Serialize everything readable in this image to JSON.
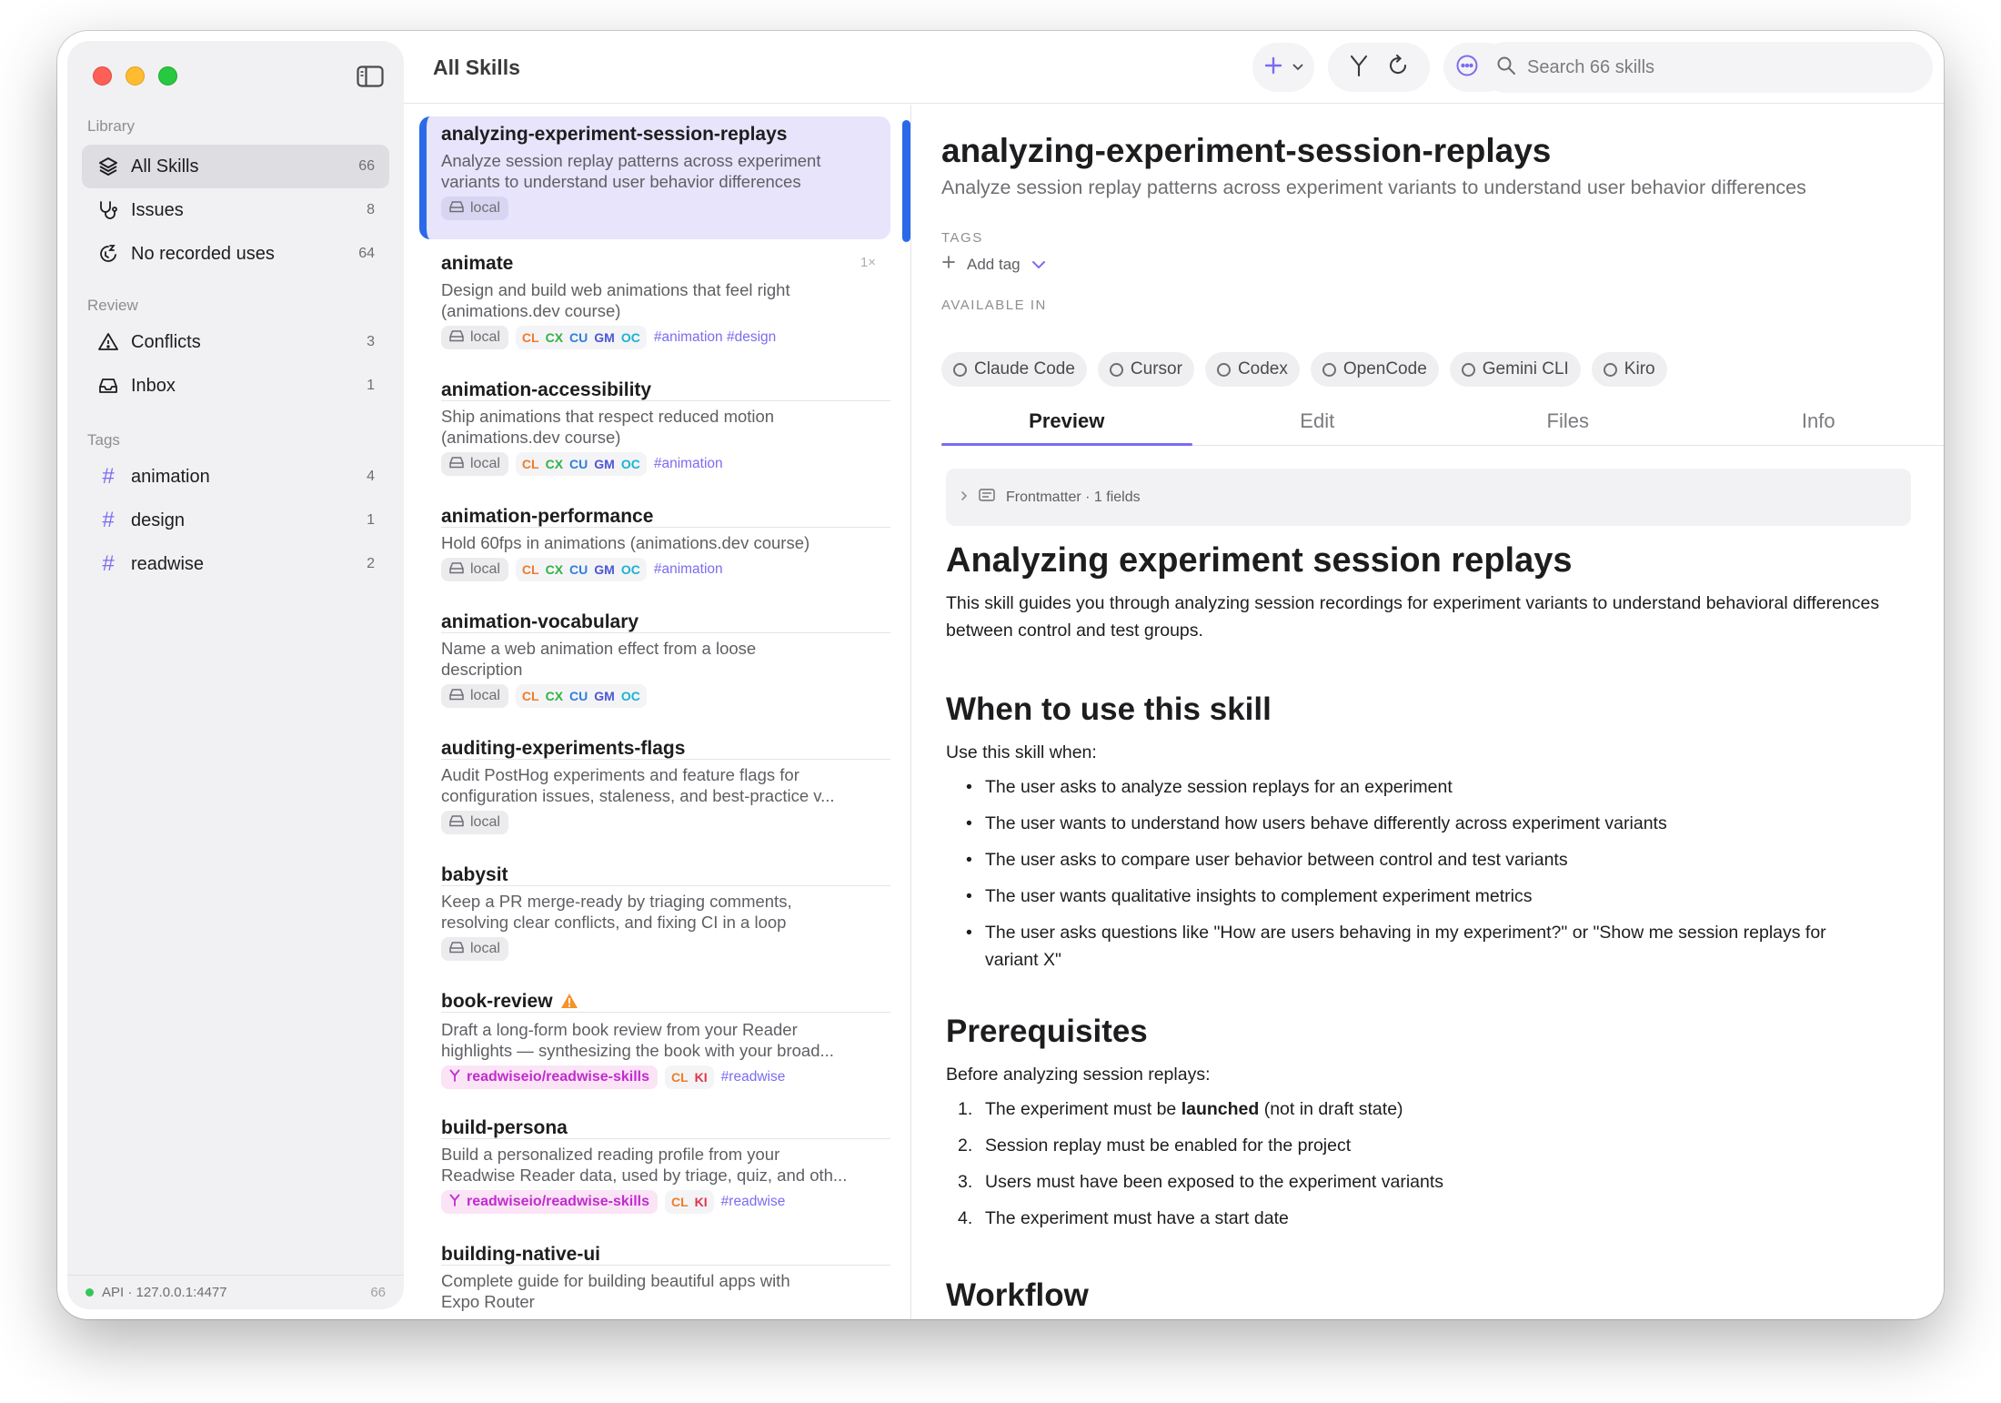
{
  "sidebar": {
    "library_heading": "Library",
    "library_items": [
      {
        "label": "All Skills",
        "count": "66"
      },
      {
        "label": "Issues",
        "count": "8"
      },
      {
        "label": "No recorded uses",
        "count": "64"
      }
    ],
    "review_heading": "Review",
    "review_items": [
      {
        "label": "Conflicts",
        "count": "3"
      },
      {
        "label": "Inbox",
        "count": "1"
      }
    ],
    "tags_heading": "Tags",
    "tag_items": [
      {
        "label": "animation",
        "count": "4"
      },
      {
        "label": "design",
        "count": "1"
      },
      {
        "label": "readwise",
        "count": "2"
      }
    ],
    "footer": {
      "api": "API · 127.0.0.1:4477",
      "count": "66"
    }
  },
  "topbar": {
    "title": "All Skills",
    "search_placeholder": "Search 66 skills"
  },
  "list": {
    "items": [
      {
        "title": "analyzing-experiment-session-replays",
        "desc1": "Analyze session replay patterns across experiment",
        "desc2": "variants to understand user behavior differences",
        "local": "local"
      },
      {
        "title": "animate",
        "usage": "1×",
        "desc1": "Design and build web animations that feel right",
        "desc2": "(animations.dev course)",
        "local": "local",
        "tags": "#animation #design"
      },
      {
        "title": "animation-accessibility",
        "desc1": "Ship animations that respect reduced motion",
        "desc2": "(animations.dev course)",
        "local": "local",
        "tags": "#animation"
      },
      {
        "title": "animation-performance",
        "desc1": "Hold 60fps in animations (animations.dev course)",
        "local": "local",
        "tags": "#animation"
      },
      {
        "title": "animation-vocabulary",
        "desc1": "Name a web animation effect from a loose",
        "desc2": "description",
        "local": "local"
      },
      {
        "title": "auditing-experiments-flags",
        "desc1": "Audit PostHog experiments and feature flags for",
        "desc2": "configuration issues, staleness, and best-practice v...",
        "local": "local"
      },
      {
        "title": "babysit",
        "desc1": "Keep a PR merge-ready by triaging comments,",
        "desc2": "resolving clear conflicts, and fixing CI in a loop",
        "local": "local"
      },
      {
        "title": "book-review",
        "desc1": "Draft a long-form book review from your Reader",
        "desc2": "highlights — synthesizing the book with your broad...",
        "repo": "readwiseio/readwise-skills",
        "tags": "#readwise"
      },
      {
        "title": "build-persona",
        "desc1": "Build a personalized reading profile from your",
        "desc2": "Readwise Reader data, used by triage, quiz, and oth...",
        "repo": "readwiseio/readwise-skills",
        "tags": "#readwise"
      },
      {
        "title": "building-native-ui",
        "desc1": "Complete guide for building beautiful apps with",
        "desc2": "Expo Router"
      }
    ],
    "agent_badges": [
      {
        "code": "CL",
        "color": "#f07b2a"
      },
      {
        "code": "CX",
        "color": "#2fb344"
      },
      {
        "code": "CU",
        "color": "#2f7de1"
      },
      {
        "code": "GM",
        "color": "#4b56d8"
      },
      {
        "code": "OC",
        "color": "#19b3d1"
      }
    ],
    "agent_badges_short": [
      {
        "code": "CL",
        "color": "#f07b2a"
      },
      {
        "code": "KI",
        "color": "#e0344a"
      }
    ]
  },
  "detail": {
    "title": "analyzing-experiment-session-replays",
    "subtitle": "Analyze session replay patterns across experiment variants to understand user behavior differences",
    "tags_label": "TAGS",
    "add_tag": "Add tag",
    "available_label": "AVAILABLE IN",
    "available": [
      "Claude Code",
      "Cursor",
      "Codex",
      "OpenCode",
      "Gemini CLI",
      "Kiro"
    ],
    "tabs": [
      "Preview",
      "Edit",
      "Files",
      "Info"
    ],
    "frontmatter": "Frontmatter · 1 fields",
    "doc": {
      "h1": "Analyzing experiment session replays",
      "intro1": "This skill guides you through analyzing session recordings for experiment variants to understand behavioral differences",
      "intro2": "between control and test groups.",
      "h2_when": "When to use this skill",
      "when_intro": "Use this skill when:",
      "when_items": [
        "The user asks to analyze session replays for an experiment",
        "The user wants to understand how users behave differently across experiment variants",
        "The user asks to compare user behavior between control and test variants",
        "The user wants qualitative insights to complement experiment metrics",
        "The user asks questions like \"How are users behaving in my experiment?\" or \"Show me session replays for"
      ],
      "when_item5_cont": "variant X\"",
      "h2_prereq": "Prerequisites",
      "prereq_intro": "Before analyzing session replays:",
      "prereq_items": [
        {
          "num": "1.",
          "pre": "The experiment must be ",
          "bold": "launched",
          "post": " (not in draft state)"
        },
        {
          "num": "2.",
          "pre": "Session replay must be enabled for the project"
        },
        {
          "num": "3.",
          "pre": "Users must have been exposed to the experiment variants"
        },
        {
          "num": "4.",
          "pre": "The experiment must have a start date"
        }
      ],
      "h2_workflow": "Workflow"
    }
  },
  "colors": {
    "accent": "#7b6cf0",
    "selection_bar": "#2a6ae8",
    "selected_card": "#e7e4fc",
    "repo_chip": "#c22bd0"
  }
}
